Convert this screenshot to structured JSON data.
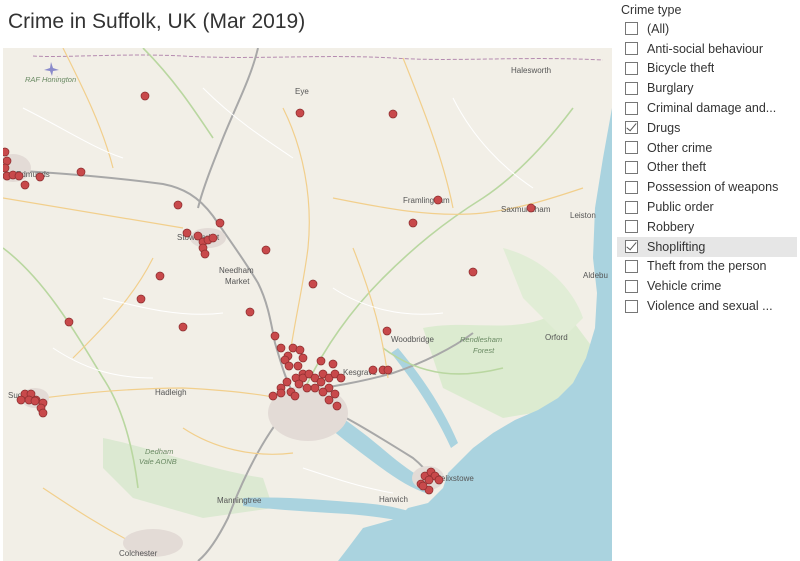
{
  "title": "Crime in Suffolk, UK (Mar 2019)",
  "filter": {
    "title": "Crime type",
    "items": [
      {
        "label": "(All)",
        "checked": false
      },
      {
        "label": "Anti-social behaviour",
        "checked": false
      },
      {
        "label": "Bicycle theft",
        "checked": false
      },
      {
        "label": "Burglary",
        "checked": false
      },
      {
        "label": "Criminal damage and...",
        "checked": false
      },
      {
        "label": "Drugs",
        "checked": true
      },
      {
        "label": "Other crime",
        "checked": false
      },
      {
        "label": "Other theft",
        "checked": false
      },
      {
        "label": "Possession of weapons",
        "checked": false
      },
      {
        "label": "Public order",
        "checked": false
      },
      {
        "label": "Robbery",
        "checked": false
      },
      {
        "label": "Shoplifting",
        "checked": true,
        "hovered": true
      },
      {
        "label": "Theft from the person",
        "checked": false
      },
      {
        "label": "Vehicle crime",
        "checked": false
      },
      {
        "label": "Violence and sexual ...",
        "checked": false
      }
    ]
  },
  "map": {
    "marker_color": "#c8494b",
    "sea_color": "#aad3df",
    "places": [
      {
        "name": "RAF Honington",
        "italic": true
      },
      {
        "name": "Halesworth"
      },
      {
        "name": "Eye"
      },
      {
        "name": "Edmunds"
      },
      {
        "name": "Framlingham"
      },
      {
        "name": "Saxmundham"
      },
      {
        "name": "Leiston"
      },
      {
        "name": "Stowmarket"
      },
      {
        "name": "Needham"
      },
      {
        "name": "Market"
      },
      {
        "name": "Aldebu"
      },
      {
        "name": "Woodbridge"
      },
      {
        "name": "Rendlesham"
      },
      {
        "name": "Forest"
      },
      {
        "name": "Orford"
      },
      {
        "name": "Kesgrave"
      },
      {
        "name": "Hadleigh"
      },
      {
        "name": "Sud"
      },
      {
        "name": "Dedham"
      },
      {
        "name": "Vale AONB"
      },
      {
        "name": "Manningtree"
      },
      {
        "name": "Harwich"
      },
      {
        "name": "Felixstowe"
      },
      {
        "name": "Colchester"
      }
    ]
  }
}
